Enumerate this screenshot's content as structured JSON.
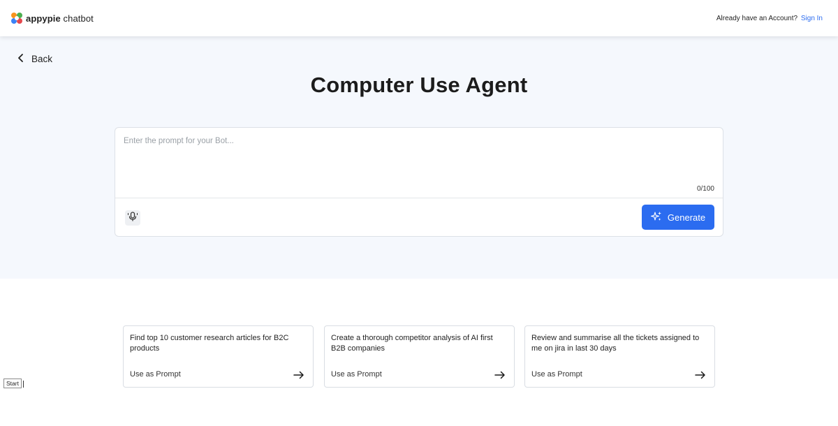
{
  "header": {
    "logo_brand": "appypie",
    "logo_product": " chatbot",
    "account_prompt": "Already have an Account?",
    "signin_label": "Sign In"
  },
  "hero": {
    "back_label": "Back",
    "title": "Computer Use Agent"
  },
  "prompt": {
    "placeholder": "Enter the prompt for your Bot...",
    "value": "",
    "counter": "0/100",
    "generate_label": "Generate"
  },
  "suggestions": [
    {
      "text": "Find top 10 customer research articles for B2C products",
      "action": "Use as Prompt"
    },
    {
      "text": "Create a thorough competitor analysis of AI first B2B companies",
      "action": "Use as Prompt"
    },
    {
      "text": "Review and summarise all the tickets assigned to me on jira in last 30 days",
      "action": "Use as Prompt"
    }
  ],
  "start_button": "Start",
  "colors": {
    "accent": "#2b6cf0",
    "hero_bg": "#f5f8fd",
    "logo_orange": "#f7931e",
    "logo_green": "#4caf50",
    "logo_blue": "#3b82f6"
  },
  "icons": {
    "logo": "appypie-logo-icon",
    "back": "chevron-left-icon",
    "mic": "microphone-icon",
    "generate": "sparkle-icon",
    "card_arrow": "arrow-right-icon"
  }
}
